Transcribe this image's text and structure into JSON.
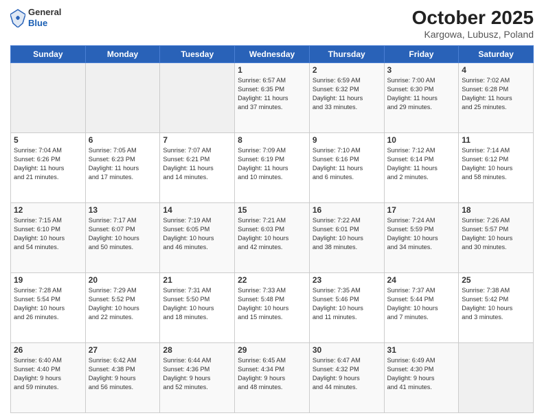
{
  "logo": {
    "general": "General",
    "blue": "Blue"
  },
  "header": {
    "month": "October 2025",
    "location": "Kargowa, Lubusz, Poland"
  },
  "days_of_week": [
    "Sunday",
    "Monday",
    "Tuesday",
    "Wednesday",
    "Thursday",
    "Friday",
    "Saturday"
  ],
  "weeks": [
    [
      {
        "day": "",
        "info": ""
      },
      {
        "day": "",
        "info": ""
      },
      {
        "day": "",
        "info": ""
      },
      {
        "day": "1",
        "info": "Sunrise: 6:57 AM\nSunset: 6:35 PM\nDaylight: 11 hours\nand 37 minutes."
      },
      {
        "day": "2",
        "info": "Sunrise: 6:59 AM\nSunset: 6:32 PM\nDaylight: 11 hours\nand 33 minutes."
      },
      {
        "day": "3",
        "info": "Sunrise: 7:00 AM\nSunset: 6:30 PM\nDaylight: 11 hours\nand 29 minutes."
      },
      {
        "day": "4",
        "info": "Sunrise: 7:02 AM\nSunset: 6:28 PM\nDaylight: 11 hours\nand 25 minutes."
      }
    ],
    [
      {
        "day": "5",
        "info": "Sunrise: 7:04 AM\nSunset: 6:26 PM\nDaylight: 11 hours\nand 21 minutes."
      },
      {
        "day": "6",
        "info": "Sunrise: 7:05 AM\nSunset: 6:23 PM\nDaylight: 11 hours\nand 17 minutes."
      },
      {
        "day": "7",
        "info": "Sunrise: 7:07 AM\nSunset: 6:21 PM\nDaylight: 11 hours\nand 14 minutes."
      },
      {
        "day": "8",
        "info": "Sunrise: 7:09 AM\nSunset: 6:19 PM\nDaylight: 11 hours\nand 10 minutes."
      },
      {
        "day": "9",
        "info": "Sunrise: 7:10 AM\nSunset: 6:16 PM\nDaylight: 11 hours\nand 6 minutes."
      },
      {
        "day": "10",
        "info": "Sunrise: 7:12 AM\nSunset: 6:14 PM\nDaylight: 11 hours\nand 2 minutes."
      },
      {
        "day": "11",
        "info": "Sunrise: 7:14 AM\nSunset: 6:12 PM\nDaylight: 10 hours\nand 58 minutes."
      }
    ],
    [
      {
        "day": "12",
        "info": "Sunrise: 7:15 AM\nSunset: 6:10 PM\nDaylight: 10 hours\nand 54 minutes."
      },
      {
        "day": "13",
        "info": "Sunrise: 7:17 AM\nSunset: 6:07 PM\nDaylight: 10 hours\nand 50 minutes."
      },
      {
        "day": "14",
        "info": "Sunrise: 7:19 AM\nSunset: 6:05 PM\nDaylight: 10 hours\nand 46 minutes."
      },
      {
        "day": "15",
        "info": "Sunrise: 7:21 AM\nSunset: 6:03 PM\nDaylight: 10 hours\nand 42 minutes."
      },
      {
        "day": "16",
        "info": "Sunrise: 7:22 AM\nSunset: 6:01 PM\nDaylight: 10 hours\nand 38 minutes."
      },
      {
        "day": "17",
        "info": "Sunrise: 7:24 AM\nSunset: 5:59 PM\nDaylight: 10 hours\nand 34 minutes."
      },
      {
        "day": "18",
        "info": "Sunrise: 7:26 AM\nSunset: 5:57 PM\nDaylight: 10 hours\nand 30 minutes."
      }
    ],
    [
      {
        "day": "19",
        "info": "Sunrise: 7:28 AM\nSunset: 5:54 PM\nDaylight: 10 hours\nand 26 minutes."
      },
      {
        "day": "20",
        "info": "Sunrise: 7:29 AM\nSunset: 5:52 PM\nDaylight: 10 hours\nand 22 minutes."
      },
      {
        "day": "21",
        "info": "Sunrise: 7:31 AM\nSunset: 5:50 PM\nDaylight: 10 hours\nand 18 minutes."
      },
      {
        "day": "22",
        "info": "Sunrise: 7:33 AM\nSunset: 5:48 PM\nDaylight: 10 hours\nand 15 minutes."
      },
      {
        "day": "23",
        "info": "Sunrise: 7:35 AM\nSunset: 5:46 PM\nDaylight: 10 hours\nand 11 minutes."
      },
      {
        "day": "24",
        "info": "Sunrise: 7:37 AM\nSunset: 5:44 PM\nDaylight: 10 hours\nand 7 minutes."
      },
      {
        "day": "25",
        "info": "Sunrise: 7:38 AM\nSunset: 5:42 PM\nDaylight: 10 hours\nand 3 minutes."
      }
    ],
    [
      {
        "day": "26",
        "info": "Sunrise: 6:40 AM\nSunset: 4:40 PM\nDaylight: 9 hours\nand 59 minutes."
      },
      {
        "day": "27",
        "info": "Sunrise: 6:42 AM\nSunset: 4:38 PM\nDaylight: 9 hours\nand 56 minutes."
      },
      {
        "day": "28",
        "info": "Sunrise: 6:44 AM\nSunset: 4:36 PM\nDaylight: 9 hours\nand 52 minutes."
      },
      {
        "day": "29",
        "info": "Sunrise: 6:45 AM\nSunset: 4:34 PM\nDaylight: 9 hours\nand 48 minutes."
      },
      {
        "day": "30",
        "info": "Sunrise: 6:47 AM\nSunset: 4:32 PM\nDaylight: 9 hours\nand 44 minutes."
      },
      {
        "day": "31",
        "info": "Sunrise: 6:49 AM\nSunset: 4:30 PM\nDaylight: 9 hours\nand 41 minutes."
      },
      {
        "day": "",
        "info": ""
      }
    ]
  ]
}
